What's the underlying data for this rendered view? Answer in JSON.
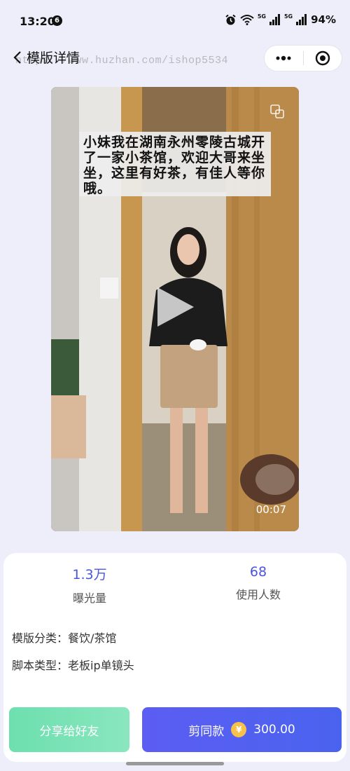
{
  "status_bar": {
    "time": "13:20",
    "notification_count": "6",
    "signal_label_1": "5G",
    "signal_label_2": "5G",
    "battery": "94%"
  },
  "nav": {
    "title": "模版详情",
    "watermark": "https://www.huzhan.com/ishop5534",
    "more_icon": "more-dots-icon",
    "close_icon": "target-close-icon"
  },
  "video": {
    "caption": "小妹我在湖南永州零陵古城开了一家小茶馆，欢迎大哥来坐坐，这里有好茶，有佳人等你哦。",
    "duration": "00:07",
    "play_icon": "play-icon",
    "fullscreen_icon": "fullscreen-icon"
  },
  "stats": {
    "exposure_value": "1.3万",
    "exposure_label": "曝光量",
    "users_value": "68",
    "users_label": "使用人数"
  },
  "meta": {
    "category": "模版分类：餐饮/茶馆",
    "script_type": "脚本类型：老板ip单镜头"
  },
  "actions": {
    "share_label": "分享给好友",
    "clone_label": "剪同款",
    "currency_symbol": "¥",
    "price": "300.00"
  },
  "colors": {
    "accent": "#4a56d8",
    "share_button": "#7ae3b6",
    "clone_button": "#5461f0",
    "coin": "#f7c24a",
    "background": "#eeeefa"
  }
}
